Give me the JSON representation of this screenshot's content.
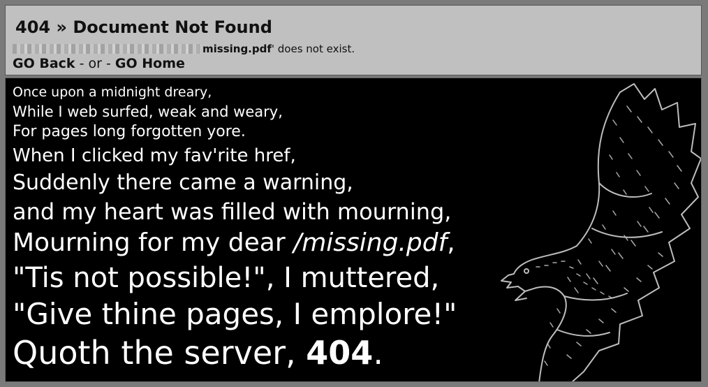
{
  "header": {
    "title": "404 » Document Not Found",
    "message_file": "missing.pdf",
    "message_rest": "' does not exist.",
    "go_back": "GO Back",
    "or": " - or - ",
    "go_home": "GO Home"
  },
  "poem": {
    "lines": [
      "Once upon a midnight dreary,",
      "While I web surfed, weak and weary,",
      "For pages long forgotten yore.",
      "When I clicked my fav'rite href,",
      "Suddenly there came a warning,",
      "and my heart was filled with mourning,",
      "Mourning for my dear ",
      "\"Tis not possible!\", I muttered,",
      "\"Give thine pages, I emplore!\"",
      "Quoth the server, "
    ],
    "missing_path": "/missing.pdf",
    "comma": ",",
    "code": "404",
    "period": "."
  },
  "icons": {
    "raven": "raven-illustration"
  }
}
